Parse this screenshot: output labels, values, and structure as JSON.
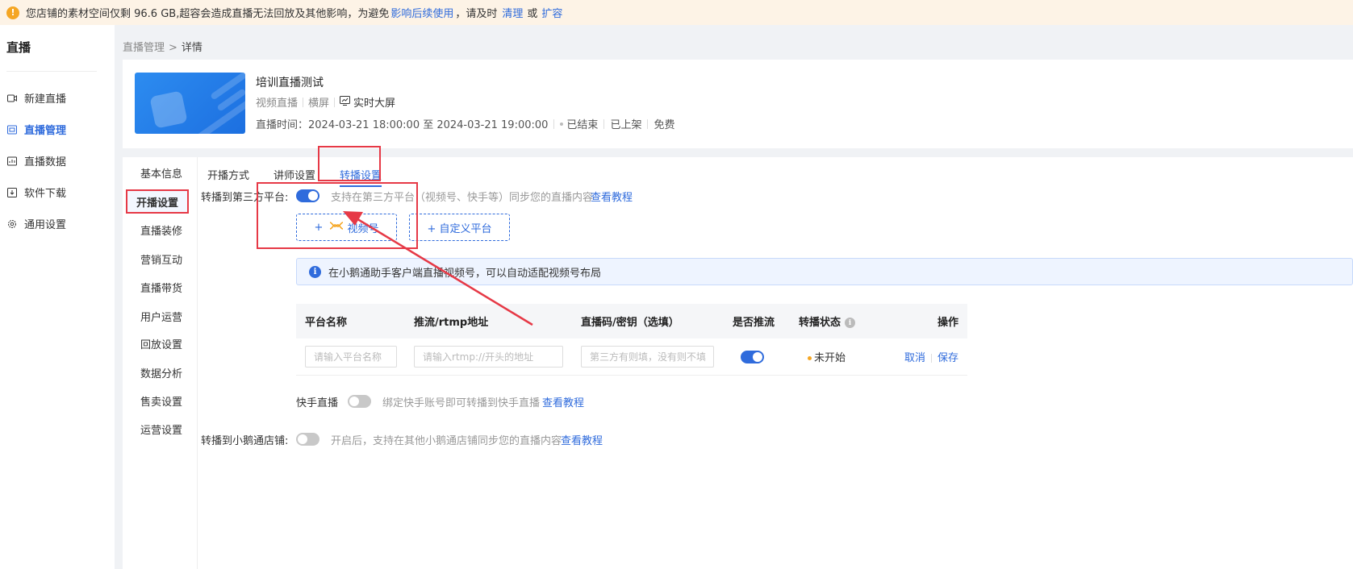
{
  "notice": {
    "text_prefix": "您店铺的素材空间仅剩 96.6 GB,超容会造成直播无法回放及其他影响，为避免",
    "link_impact": "影响后续使用",
    "text_mid": "，请及时",
    "link_clean": "清理",
    "text_or": "或",
    "link_expand": "扩容"
  },
  "left_nav": {
    "title": "直播",
    "items": [
      {
        "label": "新建直播",
        "icon": "new-live-icon",
        "active": false
      },
      {
        "label": "直播管理",
        "icon": "live-manage-icon",
        "active": true
      },
      {
        "label": "直播数据",
        "icon": "live-data-icon",
        "active": false
      },
      {
        "label": "软件下载",
        "icon": "download-icon",
        "active": false
      },
      {
        "label": "通用设置",
        "icon": "gear-icon",
        "active": false
      }
    ]
  },
  "breadcrumb": {
    "parent": "直播管理",
    "separator": ">",
    "current": "详情"
  },
  "live_card": {
    "title": "培训直播测试",
    "type": "视频直播",
    "orientation": "横屏",
    "bigscreen": "实时大屏",
    "time_label": "直播时间：",
    "time_range": "2024-03-21 18:00:00 至 2024-03-21 19:00:00",
    "status": "已结束",
    "shelf": "已上架",
    "price": "免费"
  },
  "subnav": {
    "items": [
      "基本信息",
      "开播设置",
      "直播装修",
      "营销互动",
      "直播带货",
      "用户运营",
      "回放设置",
      "数据分析",
      "售卖设置",
      "运营设置"
    ],
    "active": "开播设置"
  },
  "tabs": {
    "items": [
      "开播方式",
      "讲师设置",
      "转播设置"
    ],
    "active": "转播设置"
  },
  "relay": {
    "third_party_label": "转播到第三方平台:",
    "third_party_hint": "支持在第三方平台（视频号、快手等）同步您的直播内容",
    "tutorial": "查看教程",
    "btn_channels_plus": "+",
    "btn_channels": "视频号",
    "btn_custom": "+ 自定义平台",
    "info": "在小鹅通助手客户端直播视频号，可以自动适配视频号布局",
    "table_headers": {
      "platform": "平台名称",
      "rtmp": "推流/rtmp地址",
      "key": "直播码/密钥（选填）",
      "push": "是否推流",
      "status": "转播状态",
      "action": "操作"
    },
    "row": {
      "platform_placeholder": "请输入平台名称",
      "rtmp_placeholder": "请输入rtmp://开头的地址",
      "key_placeholder": "第三方有则填，没有则不填",
      "status": "未开始",
      "cancel": "取消",
      "save": "保存"
    },
    "kuaishou_label": "快手直播",
    "kuaishou_hint": "绑定快手账号即可转播到快手直播",
    "store_label": "转播到小鹅通店铺:",
    "store_hint": "开启后，支持在其他小鹅通店铺同步您的直播内容"
  },
  "colors": {
    "accent": "#2f6bdc",
    "highlight": "#e63946",
    "warning": "#f5a623"
  }
}
